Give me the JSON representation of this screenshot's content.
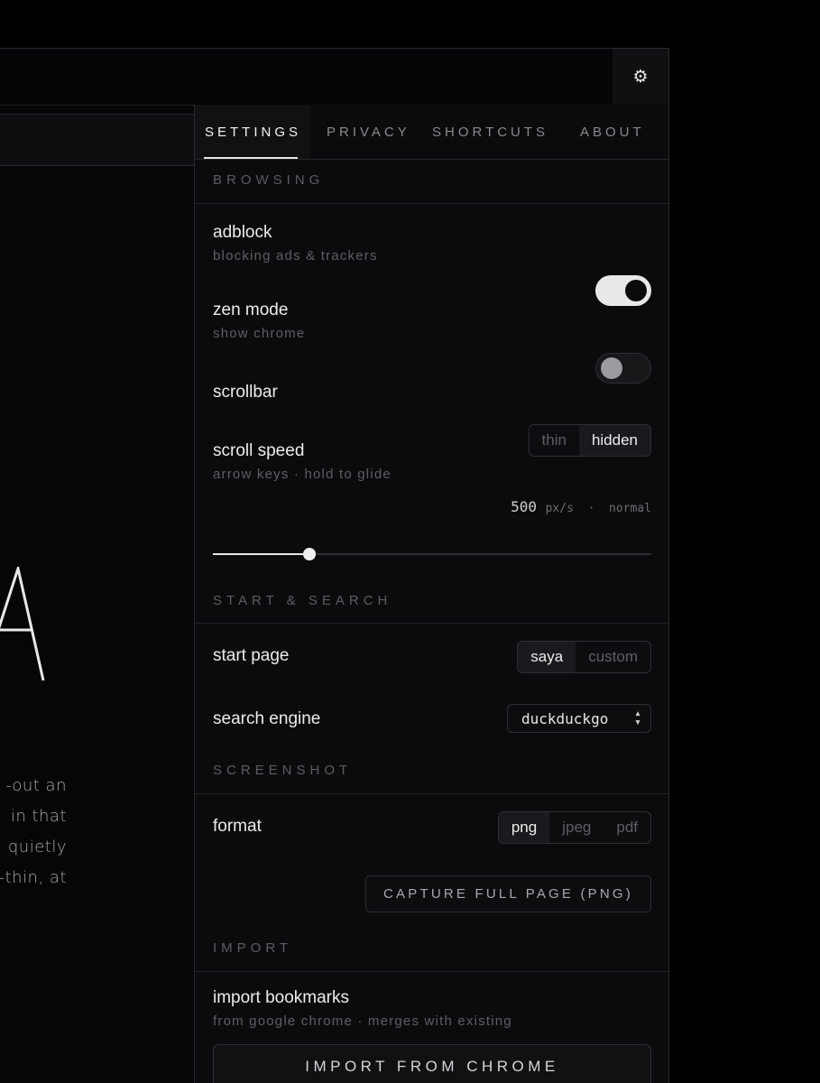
{
  "topbar": {
    "gear_icon": "gear-icon",
    "gear_glyph": "⚙"
  },
  "background_page": {
    "glyph": "A",
    "paragraph": [
      "out an-",
      "in that",
      "quietly",
      "thin, at-"
    ]
  },
  "tabs": [
    {
      "label": "SETTINGS",
      "active": true
    },
    {
      "label": "PRIVACY",
      "active": false
    },
    {
      "label": "SHORTCUTS",
      "active": false
    },
    {
      "label": "ABOUT",
      "active": false
    }
  ],
  "sections": {
    "browsing": "BROWSING",
    "start_search": "START & SEARCH",
    "screenshot": "SCREENSHOT",
    "import": "IMPORT"
  },
  "adblock": {
    "title": "adblock",
    "subtitle": "blocking ads & trackers",
    "enabled": true
  },
  "zen_mode": {
    "title": "zen mode",
    "subtitle": "show chrome",
    "enabled": false
  },
  "scrollbar": {
    "title": "scrollbar",
    "options": [
      "thin",
      "hidden"
    ],
    "selected": "hidden"
  },
  "scroll_speed": {
    "title": "scroll speed",
    "subtitle": "arrow keys · hold to glide",
    "value": "500",
    "unit": "px/s",
    "separator": "·",
    "label": "normal",
    "slider_fraction": 0.22
  },
  "start_page": {
    "title": "start page",
    "options": [
      "saya",
      "custom"
    ],
    "selected": "saya"
  },
  "search_engine": {
    "title": "search engine",
    "value": "duckduckgo",
    "chevron_icon": "chevron-updown-icon"
  },
  "format": {
    "title": "format",
    "options": [
      "png",
      "jpeg",
      "pdf"
    ],
    "selected": "png"
  },
  "capture_button": "CAPTURE FULL PAGE (PNG)",
  "import_bookmarks": {
    "title": "import bookmarks",
    "subtitle": "from google chrome · merges with existing",
    "button": "IMPORT FROM CHROME"
  },
  "colors": {
    "background": "#000000",
    "panel": "#0b0b0d",
    "accent": "#e8e8e8",
    "muted": "#5f5f64"
  }
}
